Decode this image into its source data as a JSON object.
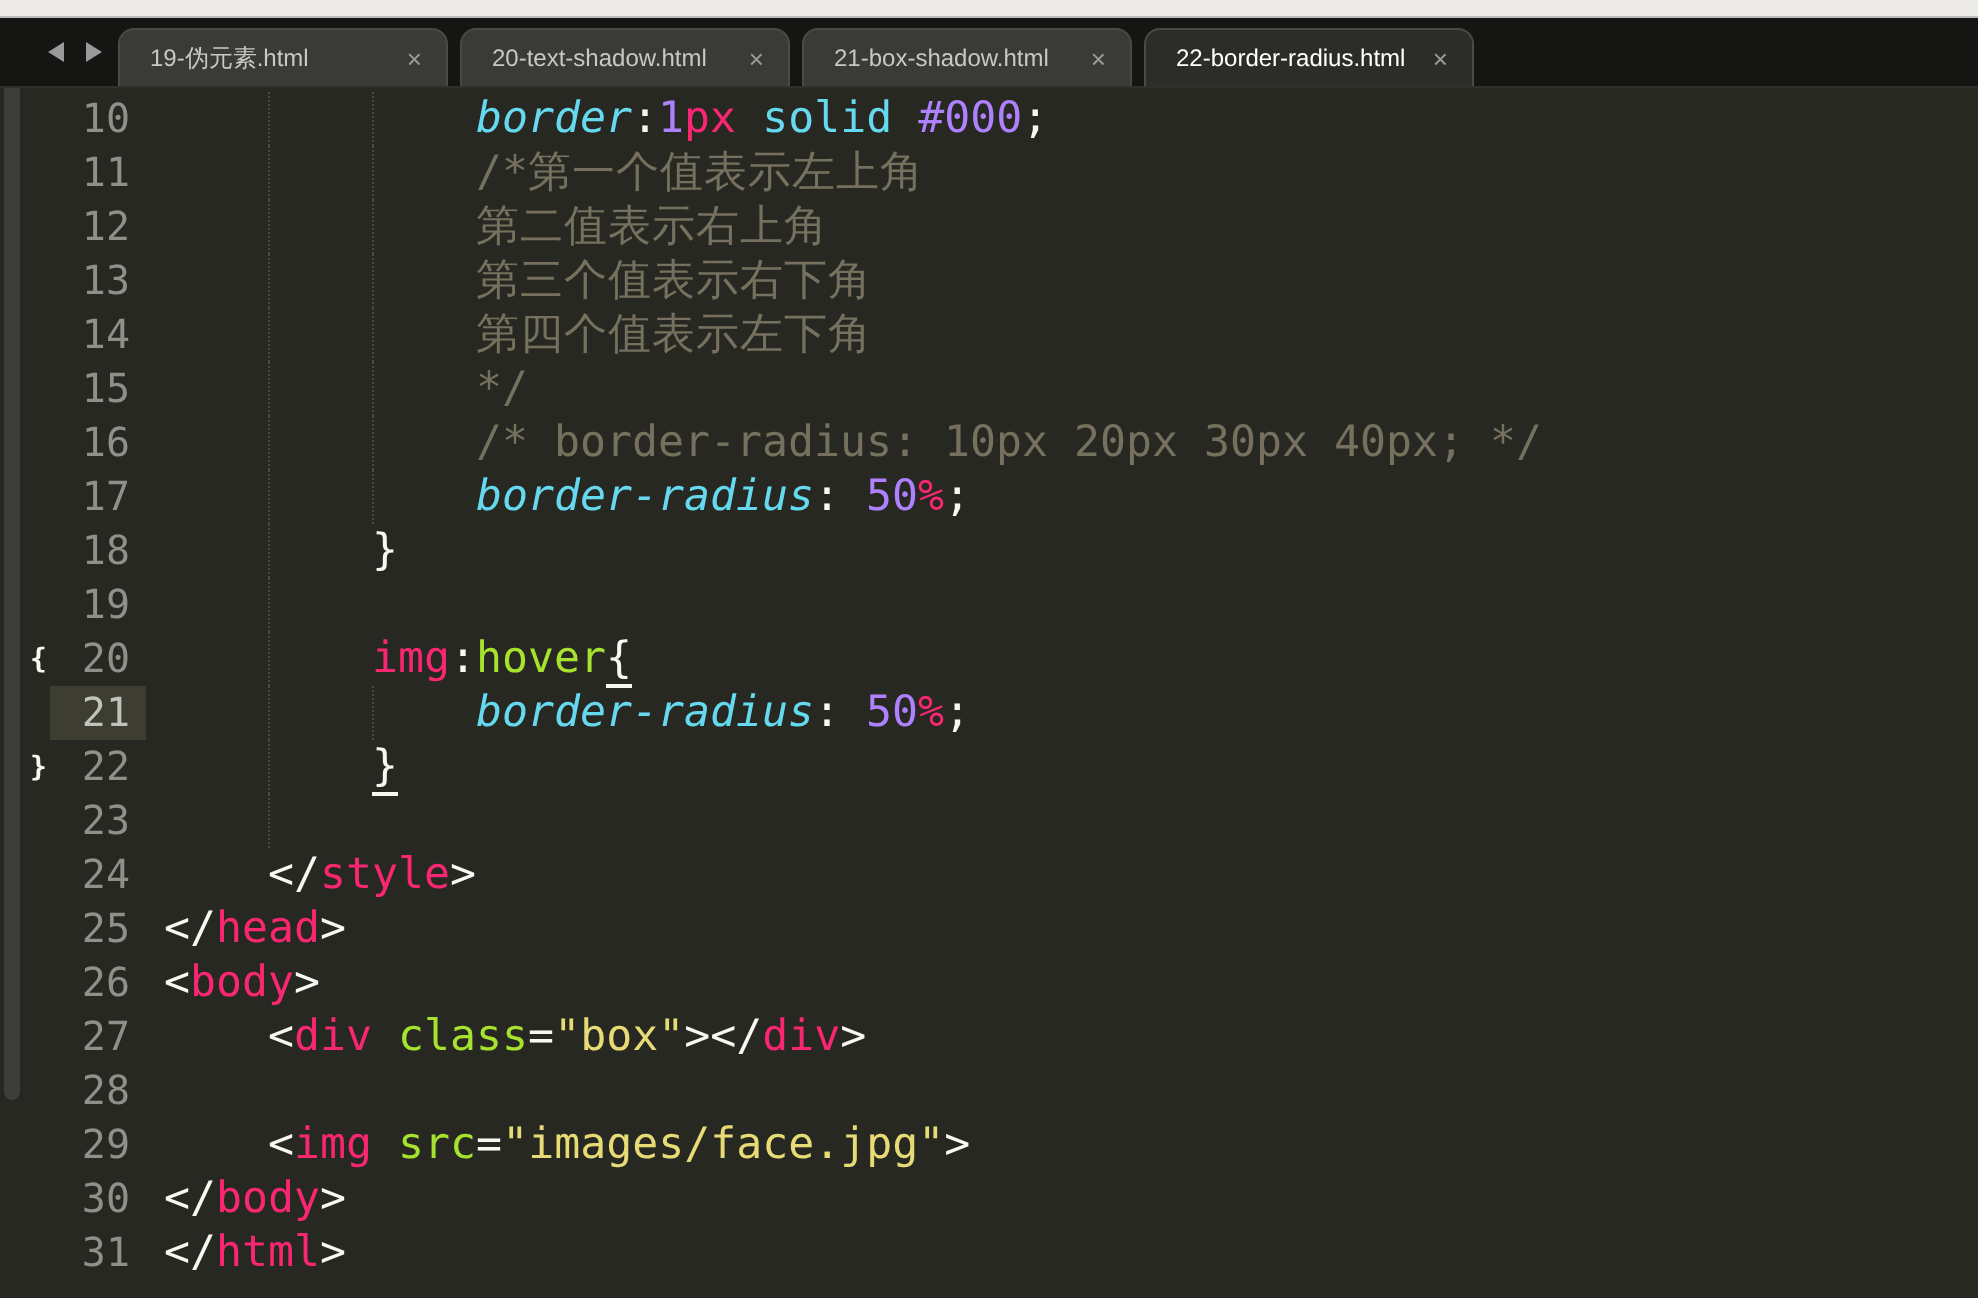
{
  "tabs": [
    {
      "label": "19-伪元素.html",
      "close": "×",
      "selected": false
    },
    {
      "label": "20-text-shadow.html",
      "close": "×",
      "selected": false
    },
    {
      "label": "21-box-shadow.html",
      "close": "×",
      "selected": false
    },
    {
      "label": "22-border-radius.html",
      "close": "×",
      "selected": true
    }
  ],
  "editor": {
    "lines": [
      {
        "number": "10",
        "current": false,
        "tokens": [
          {
            "kind": "prop",
            "text": "            border"
          },
          {
            "kind": "text",
            "text": ":"
          },
          {
            "kind": "num",
            "text": "1"
          },
          {
            "kind": "unit",
            "text": "px"
          },
          {
            "kind": "value",
            "text": " solid"
          },
          {
            "kind": "num",
            "text": " #000"
          },
          {
            "kind": "text",
            "text": ";"
          }
        ]
      },
      {
        "number": "11",
        "current": false,
        "tokens": [
          {
            "kind": "comment",
            "text": "            /*第一个值表示左上角"
          }
        ]
      },
      {
        "number": "12",
        "current": false,
        "tokens": [
          {
            "kind": "comment",
            "text": "            第二值表示右上角"
          }
        ]
      },
      {
        "number": "13",
        "current": false,
        "tokens": [
          {
            "kind": "comment",
            "text": "            第三个值表示右下角"
          }
        ]
      },
      {
        "number": "14",
        "current": false,
        "tokens": [
          {
            "kind": "comment",
            "text": "            第四个值表示左下角"
          }
        ]
      },
      {
        "number": "15",
        "current": false,
        "tokens": [
          {
            "kind": "comment",
            "text": "            */"
          }
        ]
      },
      {
        "number": "16",
        "current": false,
        "tokens": [
          {
            "kind": "comment",
            "text": "            /* border-radius: 10px 20px 30px 40px; */"
          }
        ]
      },
      {
        "number": "17",
        "current": false,
        "tokens": [
          {
            "kind": "prop",
            "text": "            border-radius"
          },
          {
            "kind": "text",
            "text": ": "
          },
          {
            "kind": "num",
            "text": "50"
          },
          {
            "kind": "unit",
            "text": "%"
          },
          {
            "kind": "text",
            "text": ";"
          }
        ]
      },
      {
        "number": "18",
        "current": false,
        "tokens": [
          {
            "kind": "text",
            "text": "        }"
          }
        ]
      },
      {
        "number": "19",
        "current": false
      },
      {
        "number": "20",
        "current": false,
        "fold_marker": "{",
        "tokens": [
          {
            "kind": "tag",
            "text": "        img"
          },
          {
            "kind": "text",
            "text": ":"
          },
          {
            "kind": "attr",
            "text": "hover"
          },
          {
            "kind": "brace-match",
            "text": "{"
          }
        ]
      },
      {
        "number": "21",
        "current": true,
        "tokens": [
          {
            "kind": "prop",
            "text": "            border-radius"
          },
          {
            "kind": "text",
            "text": ": "
          },
          {
            "kind": "num",
            "text": "50"
          },
          {
            "kind": "unit",
            "text": "%"
          },
          {
            "kind": "text",
            "text": ";"
          }
        ]
      },
      {
        "number": "22",
        "current": false,
        "fold_marker": "}",
        "tokens": [
          {
            "kind": "brace-match",
            "text": "        }"
          }
        ]
      },
      {
        "number": "23",
        "current": false
      },
      {
        "number": "24",
        "current": false,
        "tokens": [
          {
            "kind": "text",
            "text": "    </"
          },
          {
            "kind": "tag",
            "text": "style"
          },
          {
            "kind": "text",
            "text": ">"
          }
        ]
      },
      {
        "number": "25",
        "current": false,
        "tokens": [
          {
            "kind": "text",
            "text": "</"
          },
          {
            "kind": "tag",
            "text": "head"
          },
          {
            "kind": "text",
            "text": ">"
          }
        ]
      },
      {
        "number": "26",
        "current": false,
        "tokens": [
          {
            "kind": "text",
            "text": "<"
          },
          {
            "kind": "tag",
            "text": "body"
          },
          {
            "kind": "text",
            "text": ">"
          }
        ]
      },
      {
        "number": "27",
        "current": false,
        "tokens": [
          {
            "kind": "text",
            "text": "    <"
          },
          {
            "kind": "tag",
            "text": "div"
          },
          {
            "kind": "attr",
            "text": " class"
          },
          {
            "kind": "text",
            "text": "="
          },
          {
            "kind": "string",
            "text": "\"box\""
          },
          {
            "kind": "text",
            "text": "></"
          },
          {
            "kind": "tag",
            "text": "div"
          },
          {
            "kind": "text",
            "text": ">"
          }
        ]
      },
      {
        "number": "28",
        "current": false
      },
      {
        "number": "29",
        "current": false,
        "tokens": [
          {
            "kind": "text",
            "text": "    <"
          },
          {
            "kind": "tag",
            "text": "img"
          },
          {
            "kind": "attr",
            "text": " src"
          },
          {
            "kind": "text",
            "text": "="
          },
          {
            "kind": "string",
            "text": "\"images/face.jpg\""
          },
          {
            "kind": "text",
            "text": ">"
          }
        ]
      },
      {
        "number": "30",
        "current": false,
        "tokens": [
          {
            "kind": "text",
            "text": "</"
          },
          {
            "kind": "tag",
            "text": "body"
          },
          {
            "kind": "text",
            "text": ">"
          }
        ]
      },
      {
        "number": "31",
        "current": false,
        "tokens": [
          {
            "kind": "text",
            "text": "</"
          },
          {
            "kind": "tag",
            "text": "html"
          },
          {
            "kind": "text",
            "text": ">"
          }
        ]
      }
    ]
  }
}
